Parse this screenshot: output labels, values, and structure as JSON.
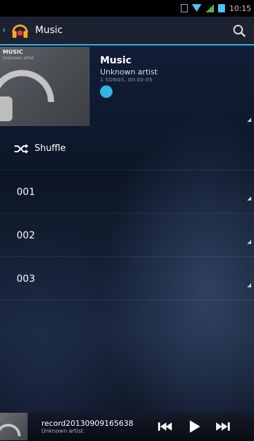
{
  "status_bar": {
    "time": "10:15"
  },
  "action_bar": {
    "title": "Music"
  },
  "album": {
    "art_title": "MUSIC",
    "art_subtitle": "Unknown artist",
    "title": "Music",
    "artist": "Unknown artist",
    "meta": "1 SONGS, 00:00:05",
    "accent": "#33b5e5"
  },
  "list": {
    "shuffle_label": "Shuffle",
    "items": [
      "001",
      "002",
      "003"
    ]
  },
  "player": {
    "title": "record20130909165638",
    "artist": "Unknown artist"
  }
}
